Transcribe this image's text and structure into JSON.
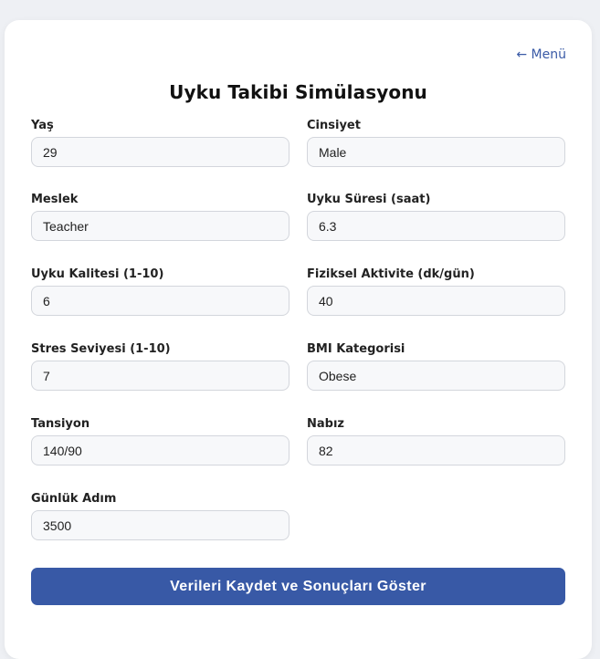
{
  "header": {
    "menu_link": "← Menü",
    "title": "Uyku Takibi Simülasyonu"
  },
  "form": {
    "fields": [
      {
        "label": "Yaş",
        "value": "29"
      },
      {
        "label": "Cinsiyet",
        "value": "Male"
      },
      {
        "label": "Meslek",
        "value": "Teacher"
      },
      {
        "label": "Uyku Süresi (saat)",
        "value": "6.3"
      },
      {
        "label": "Uyku Kalitesi (1-10)",
        "value": "6"
      },
      {
        "label": "Fiziksel Aktivite (dk/gün)",
        "value": "40"
      },
      {
        "label": "Stres Seviyesi (1-10)",
        "value": "7"
      },
      {
        "label": "BMI Kategorisi",
        "value": "Obese"
      },
      {
        "label": "Tansiyon",
        "value": "140/90"
      },
      {
        "label": "Nabız",
        "value": "82"
      },
      {
        "label": "Günlük Adım",
        "value": "3500"
      }
    ],
    "submit_label": "Verileri Kaydet ve Sonuçları Göster"
  },
  "colors": {
    "accent": "#3859a6",
    "link": "#3a5aa6",
    "background": "#eef0f4",
    "input_background": "#f7f8fa"
  }
}
